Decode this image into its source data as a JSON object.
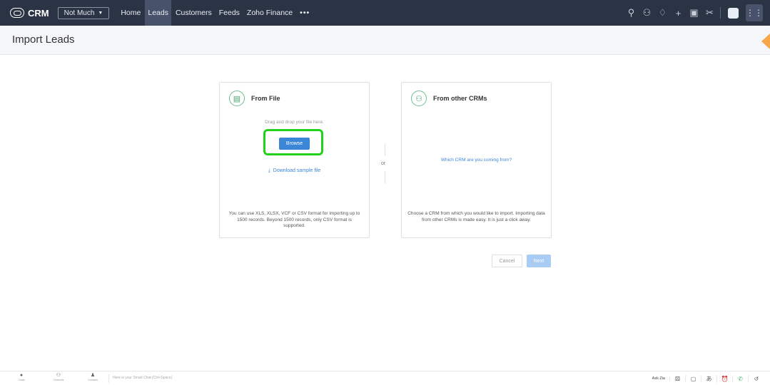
{
  "app": {
    "brand": "CRM",
    "org": "Not Much",
    "tabs": [
      {
        "label": "Home"
      },
      {
        "label": "Leads"
      },
      {
        "label": "Customers"
      },
      {
        "label": "Feeds"
      },
      {
        "label": "Zoho Finance"
      },
      {
        "label": "•••"
      }
    ],
    "active_tab": "Leads"
  },
  "icons": {
    "nav": [
      "search-icon",
      "contacts-icon",
      "bell-icon",
      "plus-icon",
      "calendar-icon",
      "tools-icon",
      "avatar",
      "apps-grid-icon"
    ],
    "bottom_left": [
      "chats-icon",
      "channels-icon",
      "contacts-icon"
    ],
    "bottom_right": [
      "game-icon",
      "notes-icon",
      "translate-icon",
      "alarm-icon",
      "phone-icon",
      "history-icon"
    ]
  },
  "page": {
    "title": "Import Leads"
  },
  "from_file": {
    "title": "From File",
    "drag_text": "Drag and drop your file here.",
    "browse_label": "Browse",
    "download_label": "Download sample file",
    "footer": "You can use XLS, XLSX, VCF or CSV format for importing up to 1500 records. Beyond 1500 records, only CSV format is supported."
  },
  "separator": {
    "label": "or"
  },
  "from_crm": {
    "title": "From other CRMs",
    "link": "Which CRM are you coming from?",
    "footer": "Choose a CRM from which you would like to import. Importing data from other CRMs is made easy. It is just a click away."
  },
  "actions": {
    "cancel": "Cancel",
    "next": "Next"
  },
  "bottombar": {
    "items": [
      {
        "label": "Chats"
      },
      {
        "label": "Channels"
      },
      {
        "label": "Contacts"
      }
    ],
    "smart_chat": "Here is your Smart Chat (Ctrl+Space)",
    "ask_zia": "Ask Zia"
  },
  "colors": {
    "nav_bg": "#2b3445",
    "accent": "#3b86d6",
    "highlight": "#22d11c",
    "card_icon": "#4ea06c"
  }
}
